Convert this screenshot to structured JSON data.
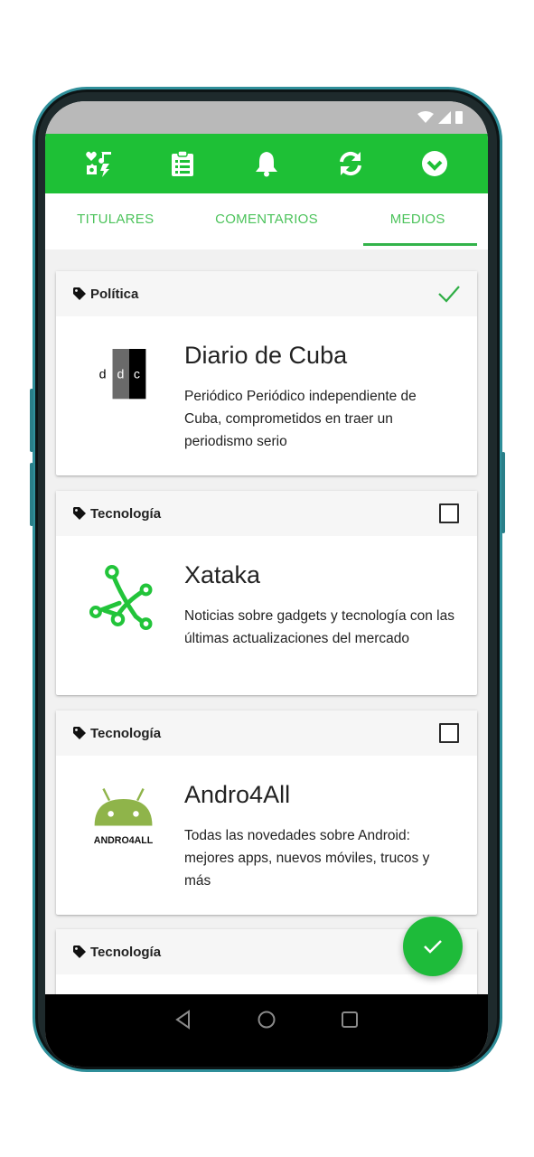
{
  "colors": {
    "accent": "#1ec036",
    "tab_text": "#4cc35b",
    "fab": "#1ebb3a"
  },
  "appbar": {
    "icons": [
      "categories-icon",
      "clipboard-icon",
      "bell-icon",
      "sync-icon",
      "check-circle-icon"
    ]
  },
  "tabs": [
    {
      "label": "TITULARES",
      "active": false
    },
    {
      "label": "COMENTARIOS",
      "active": false
    },
    {
      "label": "MEDIOS",
      "active": true
    }
  ],
  "cards": [
    {
      "category": "Política",
      "selected": true,
      "logo": "ddc-logo",
      "logo_text": "d d c",
      "title": "Diario de Cuba",
      "description": "Periódico Periódico independiente de Cuba, comprometidos en traer un periodismo serio"
    },
    {
      "category": "Tecnología",
      "selected": false,
      "logo": "xataka-logo",
      "title": "Xataka",
      "description": "Noticias sobre gadgets y tecnología con las últimas actualizaciones del mercado"
    },
    {
      "category": "Tecnología",
      "selected": false,
      "logo": "andro4all-logo",
      "logo_text": "ANDRO4ALL",
      "title": "Andro4All",
      "description": "Todas las novedades sobre Android: mejores apps, nuevos móviles, trucos y más"
    },
    {
      "category": "Tecnología",
      "selected": false
    }
  ],
  "fab": {
    "icon": "check-icon"
  },
  "navbar": {
    "icons": [
      "back-icon",
      "home-icon",
      "recents-icon"
    ]
  }
}
